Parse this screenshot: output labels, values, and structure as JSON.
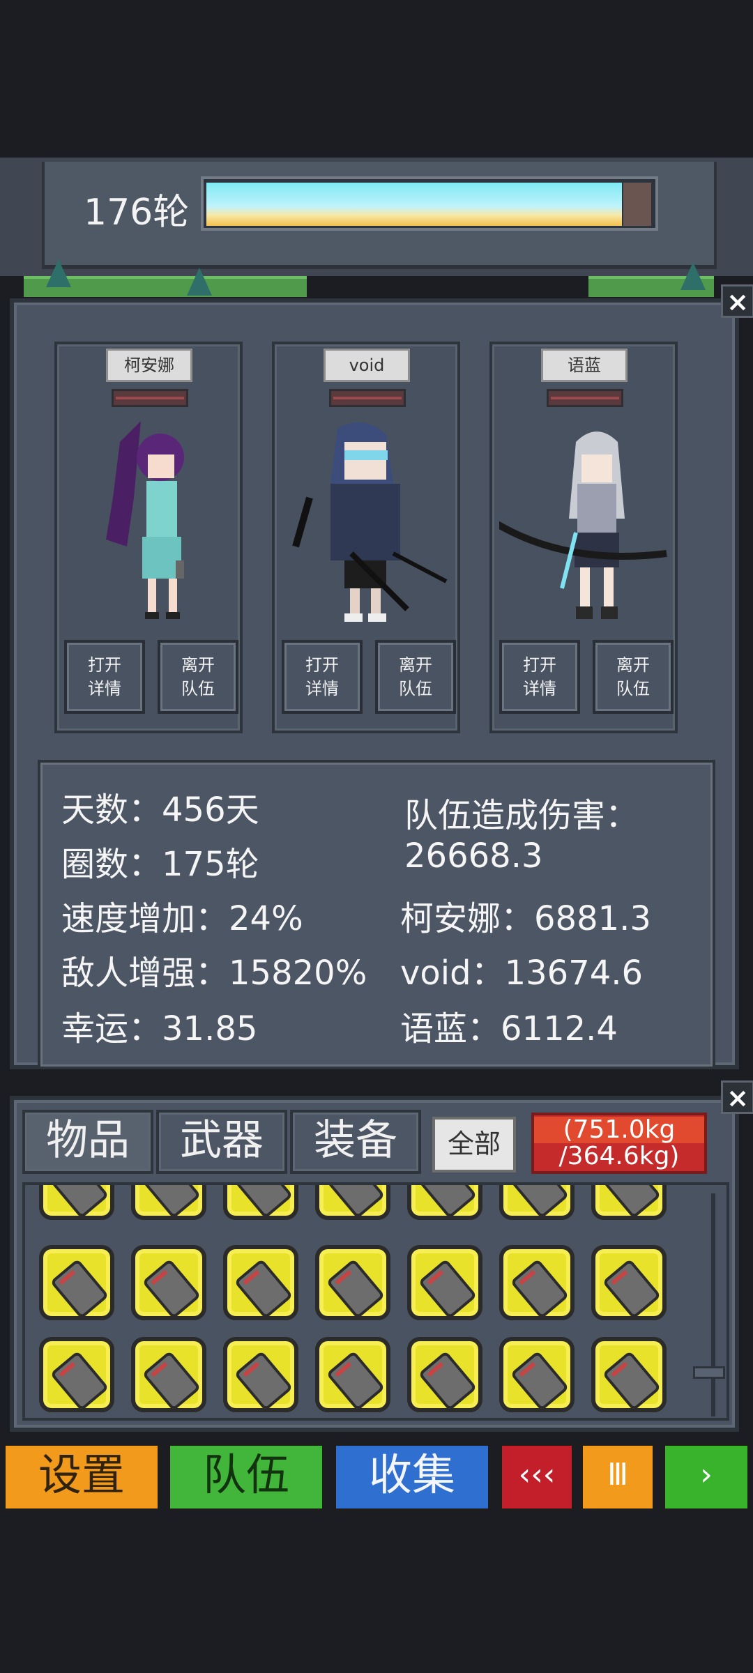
{
  "round_bar": {
    "label": "176轮",
    "progress_fraction": 0.93
  },
  "team": {
    "members": [
      {
        "name": "柯安娜",
        "detail_label": "打开\n详情",
        "leave_label": "离开\n队伍"
      },
      {
        "name": "void",
        "detail_label": "打开\n详情",
        "leave_label": "离开\n队伍"
      },
      {
        "name": "语蓝",
        "detail_label": "打开\n详情",
        "leave_label": "离开\n队伍"
      }
    ],
    "stats": {
      "days": "天数：456天",
      "rounds": "圈数：175轮",
      "speed": "速度增加：24%",
      "enemy": "敌人增强：15820%",
      "luck": "幸运：31.85",
      "damage_title": "队伍造成伤害：",
      "damage_total": "26668.3",
      "dmg_1": "柯安娜：6881.3",
      "dmg_2": "void：13674.6",
      "dmg_3": "语蓝：6112.4"
    }
  },
  "inventory": {
    "tabs": [
      "物品",
      "武器",
      "装备"
    ],
    "all_label": "全部",
    "weight_line1": "(751.0kg",
    "weight_line2": "/364.6kg)",
    "item_icon": "grenade-shell-icon"
  },
  "bottom_bar": {
    "settings": "设置",
    "team": "队伍",
    "collect": "收集",
    "rewind": "‹‹‹",
    "pause": "Ⅲ",
    "play": "›"
  },
  "colors": {
    "panel": "#4b5462",
    "settings": "#f19a1c",
    "team": "#42b63b",
    "collect": "#2f6fd0",
    "rewind": "#c21f2a",
    "weight_badge": "#c62b2b",
    "item_bg": "#e8e22a"
  }
}
